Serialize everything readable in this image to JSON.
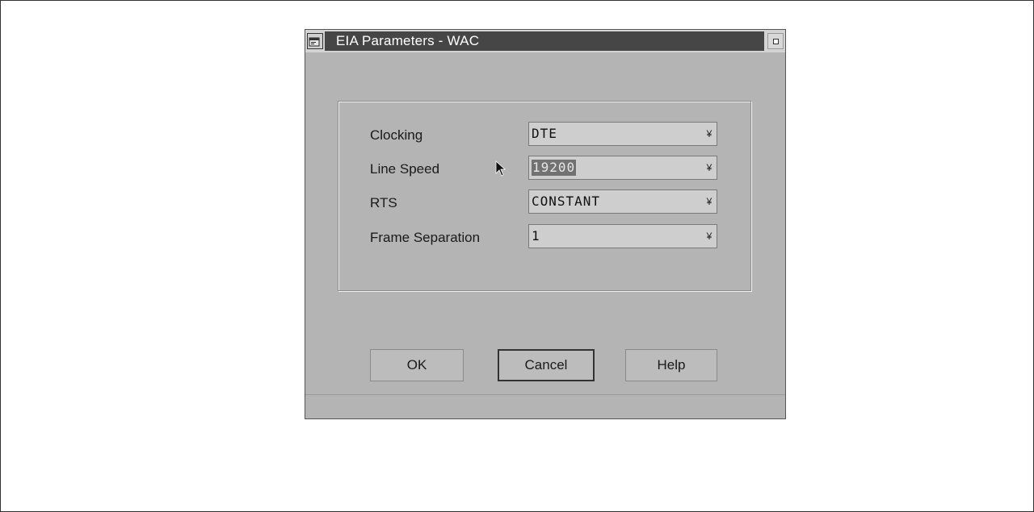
{
  "window": {
    "title": "EIA Parameters - WAC"
  },
  "icons": {
    "system_menu": "system-menu-icon",
    "minimize": "minimize-icon",
    "dropdown": "dropdown-arrow-icon",
    "cursor": "mouse-pointer-icon"
  },
  "fields": [
    {
      "label": "Clocking",
      "value": "DTE",
      "selected": false
    },
    {
      "label": "Line Speed",
      "value": "19200",
      "selected": true
    },
    {
      "label": "RTS",
      "value": "CONSTANT",
      "selected": false
    },
    {
      "label": "Frame Separation",
      "value": "1",
      "selected": false
    }
  ],
  "dropdown_arrow_glyph": "¥",
  "buttons": {
    "ok": "OK",
    "cancel": "Cancel",
    "help": "Help"
  },
  "colors": {
    "title_bar": "#2a2a2a",
    "dialog_background": "#d4d4d4"
  }
}
